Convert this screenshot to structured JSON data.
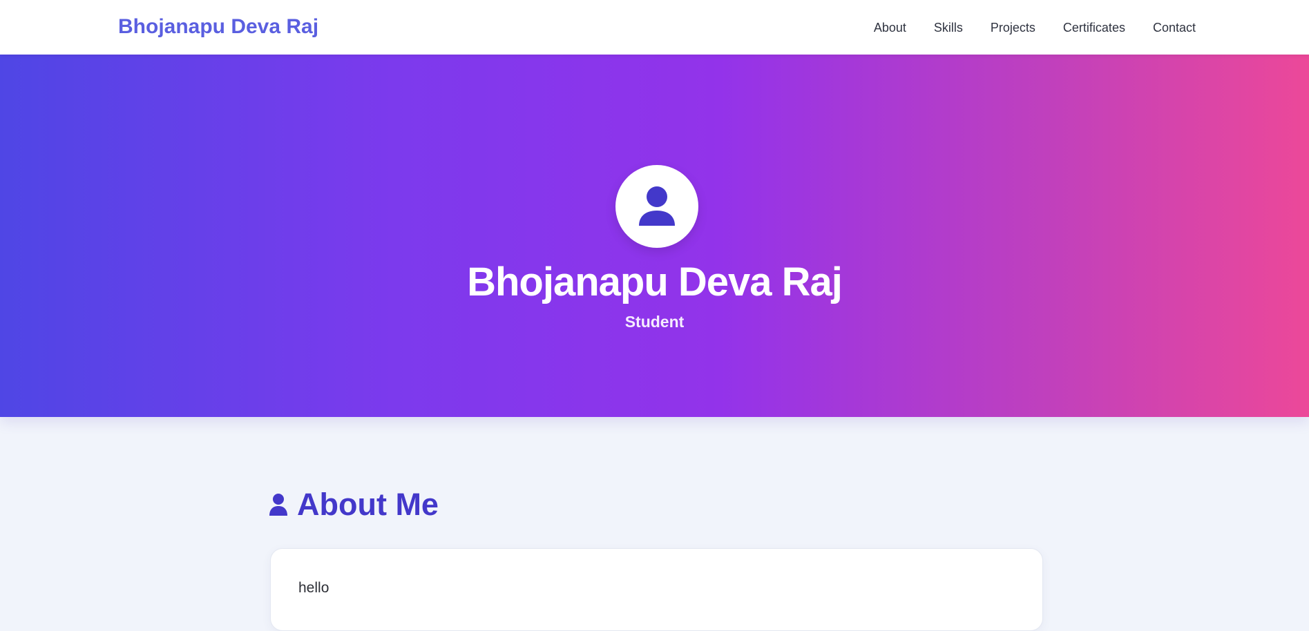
{
  "navbar": {
    "brand": "Bhojanapu Deva Raj",
    "links": [
      "About",
      "Skills",
      "Projects",
      "Certificates",
      "Contact"
    ]
  },
  "hero": {
    "name": "Bhojanapu Deva Raj",
    "subtitle": "Student",
    "avatar_icon": "user-icon"
  },
  "about": {
    "heading": "About Me",
    "heading_icon": "user-icon",
    "text": "hello"
  },
  "colors": {
    "brand": "#5a5fe0",
    "accent": "#4338ca",
    "gradient_start": "#4f46e5",
    "gradient_mid": "#9333ea",
    "gradient_end": "#ec4899"
  }
}
